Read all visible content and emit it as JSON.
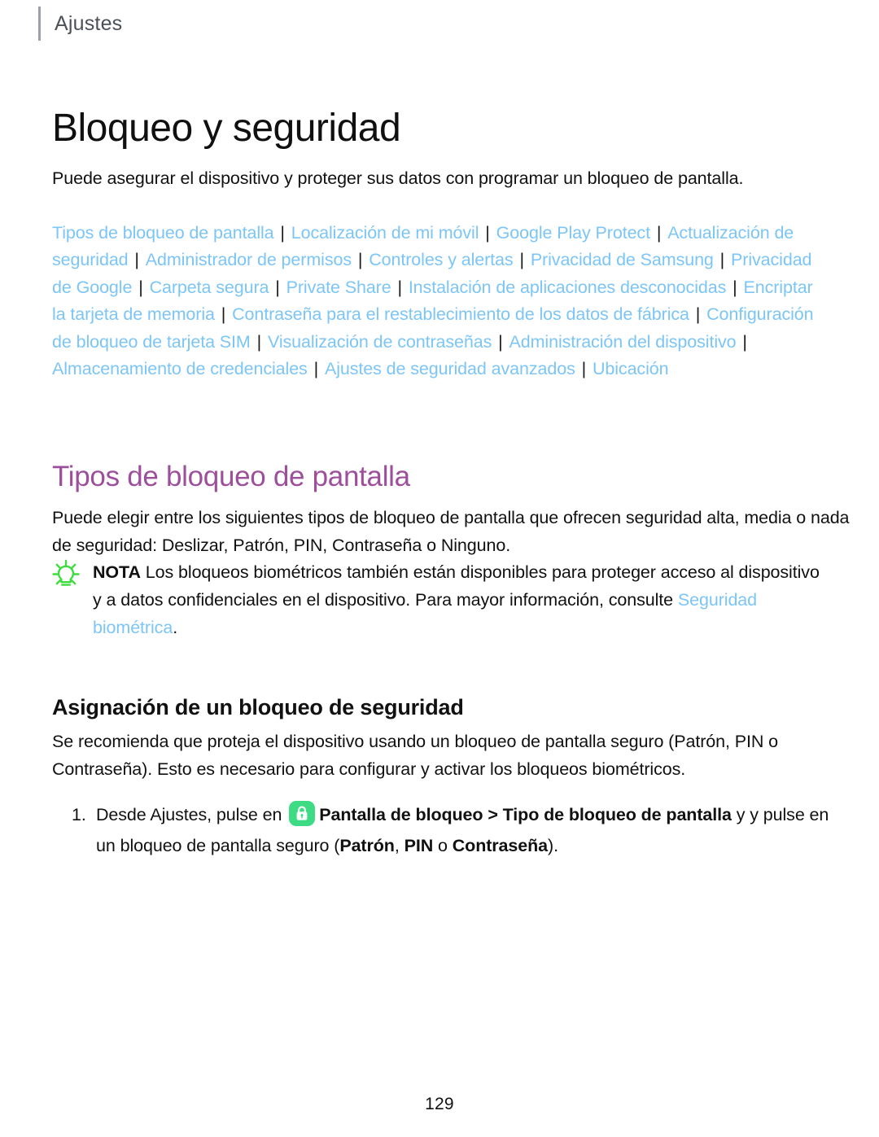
{
  "header": {
    "running_label": "Ajustes"
  },
  "title": "Bloqueo y seguridad",
  "intro_paragraph": "Puede asegurar el dispositivo y proteger sus datos con programar un bloqueo de pantalla.",
  "link_list": {
    "separator": "|",
    "links": [
      "Tipos de bloqueo de pantalla",
      "Localización de mi móvil",
      "Google Play Protect",
      "Actualización de seguridad",
      "Administrador de permisos",
      "Controles y alertas",
      "Privacidad de Samsung",
      "Privacidad de Google",
      "Carpeta segura",
      "Private Share",
      "Instalación de aplicaciones desconocidas",
      "Encriptar la tarjeta de memoria",
      "Contraseña para el restablecimiento de los datos de fábrica",
      "Configuración de bloqueo de tarjeta SIM",
      "Visualización de contraseñas",
      "Administración del dispositivo",
      "Almacenamiento de credenciales",
      "Ajustes de seguridad avanzados",
      "Ubicación"
    ]
  },
  "section": {
    "heading": "Tipos de bloqueo de pantalla",
    "paragraph": "Puede elegir entre los siguientes tipos de bloqueo de pantalla que ofrecen seguridad alta, media o nada de seguridad: Deslizar, Patrón, PIN, Contraseña o Ninguno."
  },
  "note": {
    "icon": "lightbulb-icon",
    "label": "NOTA",
    "text_before_link": "Los bloqueos biométricos también están disponibles para proteger acceso al dispositivo y a datos confidenciales en el dispositivo. Para mayor información, consulte ",
    "link_text": "Seguridad biométrica",
    "text_after_link": "."
  },
  "subsection": {
    "heading": "Asignación de un bloqueo de seguridad",
    "paragraph": "Se recomienda que proteja el dispositivo usando un bloqueo de pantalla seguro (Patrón, PIN o Contraseña). Esto es necesario para configurar y activar los bloqueos biométricos."
  },
  "step": {
    "number": "1.",
    "text_1": "Desde Ajustes, pulse en",
    "icon": "lock-icon",
    "bold_1": "Pantalla de bloqueo",
    "chevron": ">",
    "bold_2": "Tipo de bloqueo de pantalla",
    "text_2": "y pulse en un bloqueo de pantalla seguro (",
    "bold_3": "Patrón",
    "text_3": ",",
    "bold_4": "PIN",
    "text_4": "o",
    "bold_5": "Contraseña",
    "text_5": ")."
  },
  "page_number": "129",
  "colors": {
    "link_blue": "#7cc5f7",
    "heading_purple": "#9e4f9c",
    "accent_green": "#3ddc84",
    "note_icon_green": "#3ddc3d",
    "rule_gray": "#9aa0a6"
  }
}
